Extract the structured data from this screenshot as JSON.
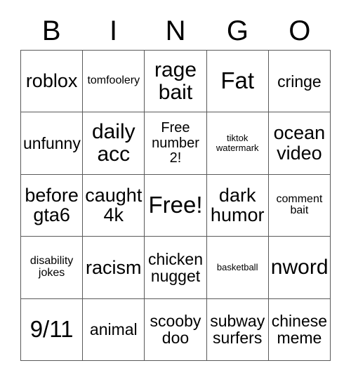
{
  "card": {
    "header_letters": [
      "B",
      "I",
      "N",
      "G",
      "O"
    ],
    "free_space_label": "Free!",
    "cells": [
      {
        "text": "roblox",
        "size": "fs-lg"
      },
      {
        "text": "tomfoolery",
        "size": "fs-xs"
      },
      {
        "text": "rage\nbait",
        "size": "fs-xl"
      },
      {
        "text": "Fat",
        "size": "fs-xxl"
      },
      {
        "text": "cringe",
        "size": "fs-md"
      },
      {
        "text": "unfunny",
        "size": "fs-md"
      },
      {
        "text": "daily\nacc",
        "size": "fs-xl"
      },
      {
        "text": "Free\nnumber\n2!",
        "size": "fs-sm"
      },
      {
        "text": "tiktok\nwatermark",
        "size": "fs-xxs"
      },
      {
        "text": "ocean\nvideo",
        "size": "fs-lg"
      },
      {
        "text": "before\ngta6",
        "size": "fs-lg"
      },
      {
        "text": "caught\n4k",
        "size": "fs-lg"
      },
      {
        "text": "Free!",
        "size": "fs-xxl"
      },
      {
        "text": "dark\nhumor",
        "size": "fs-lg"
      },
      {
        "text": "comment\nbait",
        "size": "fs-xs"
      },
      {
        "text": "disability\njokes",
        "size": "fs-xs"
      },
      {
        "text": "racism",
        "size": "fs-lg"
      },
      {
        "text": "chicken\nnugget",
        "size": "fs-md"
      },
      {
        "text": "basketball",
        "size": "fs-xxs"
      },
      {
        "text": "nword",
        "size": "fs-xl"
      },
      {
        "text": "9/11",
        "size": "fs-xxl"
      },
      {
        "text": "animal",
        "size": "fs-md"
      },
      {
        "text": "scooby\ndoo",
        "size": "fs-md"
      },
      {
        "text": "subway\nsurfers",
        "size": "fs-md"
      },
      {
        "text": "chinese\nmeme",
        "size": "fs-md"
      }
    ],
    "colors": {
      "background": "#ffffff",
      "text": "#000000",
      "border": "#5a5a5a"
    }
  }
}
